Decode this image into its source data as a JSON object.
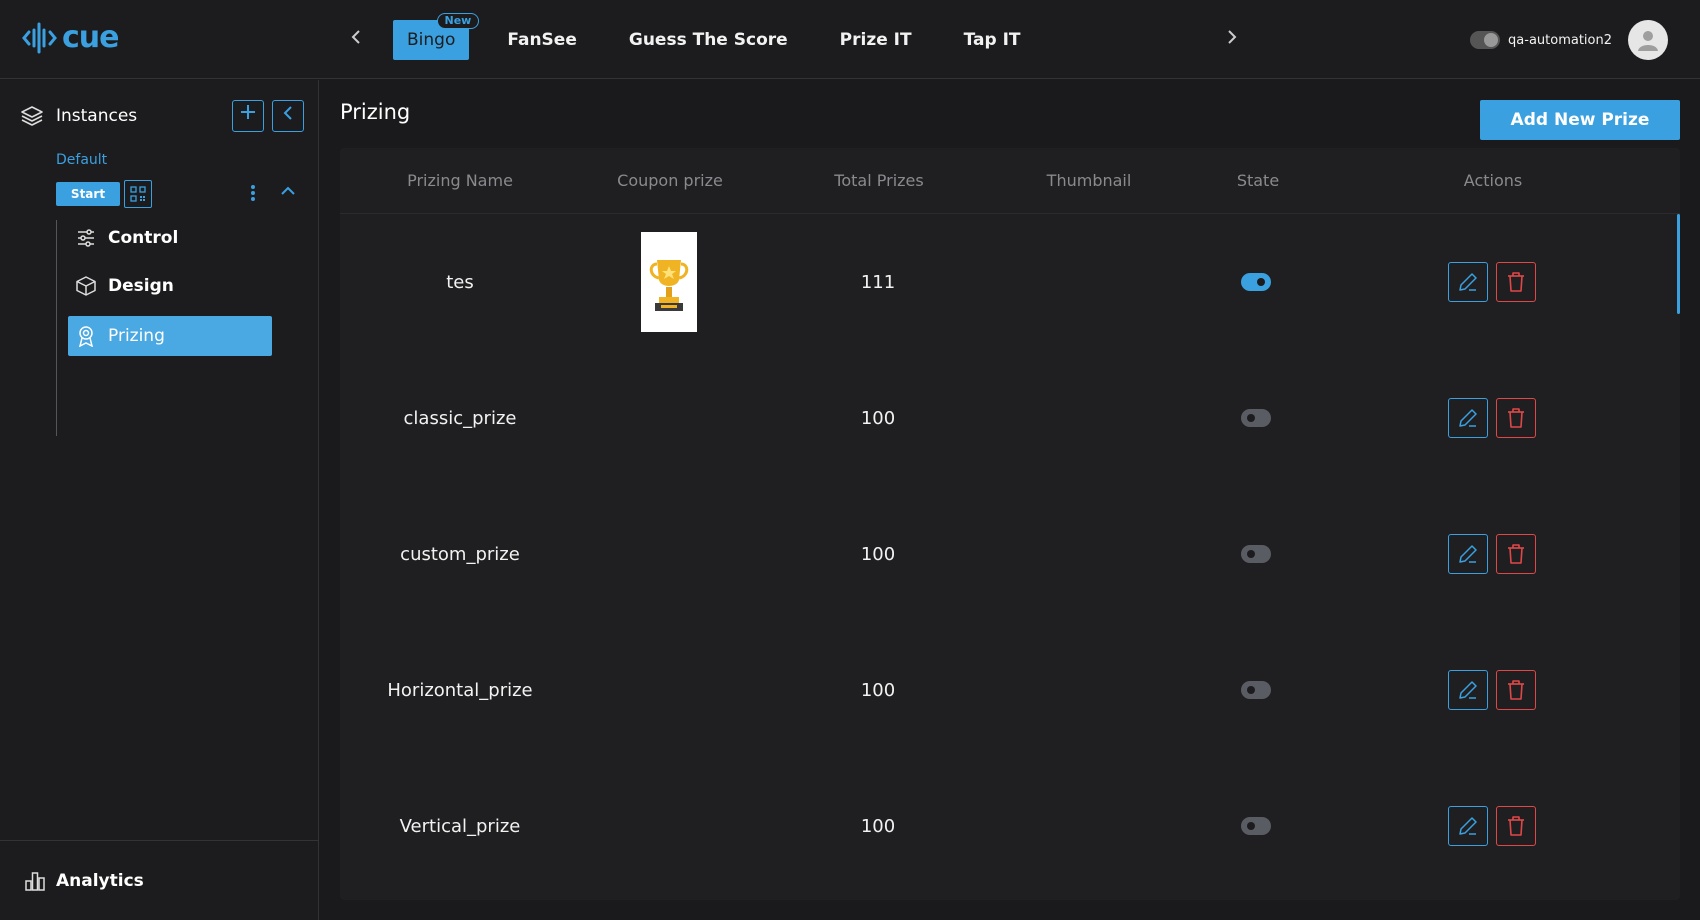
{
  "app": {
    "logo_text": "cue",
    "brand_color": "#3aa0e0"
  },
  "top_nav": {
    "tabs": [
      {
        "label": "Bingo",
        "badge": "New",
        "active": true
      },
      {
        "label": "FanSee"
      },
      {
        "label": "Guess The Score"
      },
      {
        "label": "Prize IT"
      },
      {
        "label": "Tap IT"
      }
    ],
    "prev_icon": "chevron-left-icon",
    "next_icon": "chevron-right-icon",
    "username": "qa-automation2"
  },
  "sidebar": {
    "section_label": "Instances",
    "instance_name": "Default",
    "start_label": "Start",
    "items": [
      {
        "label": "Control",
        "icon": "sliders-icon"
      },
      {
        "label": "Design",
        "icon": "cube-icon"
      },
      {
        "label": "Prizing",
        "icon": "award-icon",
        "active": true
      }
    ],
    "bottom_label": "Analytics"
  },
  "main": {
    "title": "Prizing",
    "add_button_label": "Add New Prize",
    "table": {
      "columns": [
        "Prizing Name",
        "Coupon prize",
        "Total Prizes",
        "Thumbnail",
        "State",
        "Actions"
      ],
      "rows": [
        {
          "name": "tes",
          "coupon_prize": "trophy-image",
          "total": "111",
          "state": true
        },
        {
          "name": "classic_prize",
          "coupon_prize": "",
          "total": "100",
          "state": false
        },
        {
          "name": "custom_prize",
          "coupon_prize": "",
          "total": "100",
          "state": false
        },
        {
          "name": "Horizontal_prize",
          "coupon_prize": "",
          "total": "100",
          "state": false
        },
        {
          "name": "Vertical_prize",
          "coupon_prize": "",
          "total": "100",
          "state": false
        }
      ]
    }
  }
}
